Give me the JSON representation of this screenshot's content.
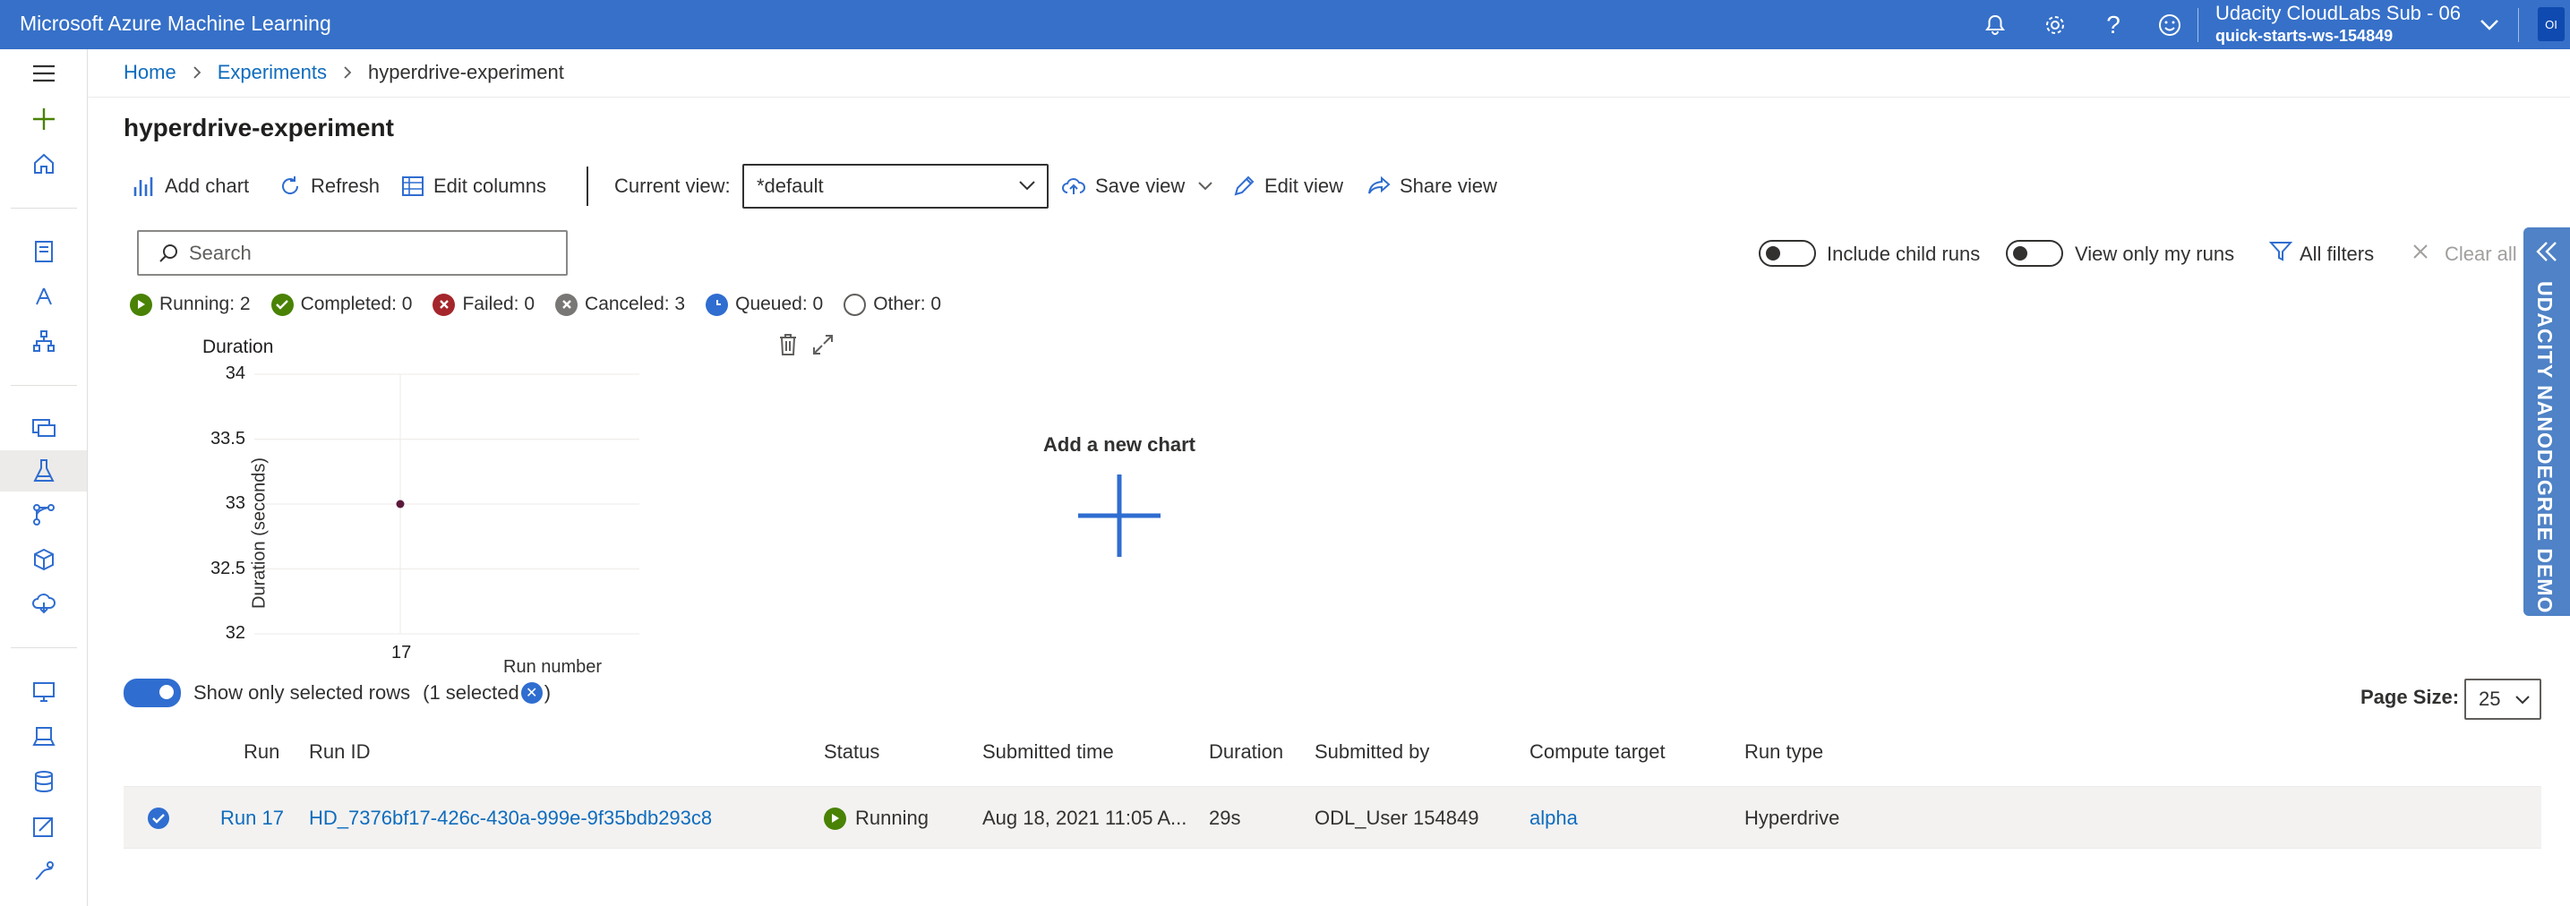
{
  "app": {
    "title": "Microsoft Azure Machine Learning"
  },
  "account": {
    "name": "Udacity CloudLabs Sub - 06",
    "workspace": "quick-starts-ws-154849",
    "initials": "OI"
  },
  "breadcrumb": {
    "items": [
      "Home",
      "Experiments"
    ],
    "current": "hyperdrive-experiment"
  },
  "page": {
    "title": "hyperdrive-experiment"
  },
  "toolbar": {
    "add_chart": "Add chart",
    "refresh": "Refresh",
    "edit_columns": "Edit columns",
    "current_view_label": "Current view:",
    "current_view_value": "*default",
    "save_view": "Save view",
    "edit_view": "Edit view",
    "share_view": "Share view"
  },
  "search": {
    "placeholder": "Search"
  },
  "filters": {
    "include_child_runs": "Include child runs",
    "include_child_runs_on": false,
    "view_only_my_runs": "View only my runs",
    "view_only_my_runs_on": false,
    "all_filters": "All filters",
    "clear_all": "Clear all"
  },
  "status_counts": [
    {
      "label": "Running: 2",
      "color": "#498205",
      "icon": "play-icon"
    },
    {
      "label": "Completed: 0",
      "color": "#498205",
      "icon": "check-icon"
    },
    {
      "label": "Failed: 0",
      "color": "#a4262c",
      "icon": "x-icon"
    },
    {
      "label": "Canceled: 3",
      "color": "#797775",
      "icon": "x-icon"
    },
    {
      "label": "Queued: 0",
      "color": "#2f6dd0",
      "icon": "clock-icon"
    },
    {
      "label": "Other: 0",
      "color": "#ffffff",
      "icon": "circle-icon"
    }
  ],
  "chart_data": {
    "type": "scatter",
    "title": "Duration",
    "xlabel": "Run number",
    "ylabel": "Duration (seconds)",
    "x": [
      17
    ],
    "y": [
      33
    ],
    "x_ticks": [
      "17"
    ],
    "y_ticks": [
      "34",
      "33.5",
      "33",
      "32.5",
      "32"
    ],
    "ylim": [
      32,
      34
    ],
    "grid": true
  },
  "new_chart": {
    "label": "Add a new chart"
  },
  "selection": {
    "toggle_label": "Show only selected rows",
    "toggle_on": true,
    "count_prefix": "(1 selected",
    "count_suffix": ")"
  },
  "page_size": {
    "label": "Page Size:",
    "value": "25"
  },
  "table": {
    "columns": [
      "Run",
      "Run ID",
      "Status",
      "Submitted time",
      "Duration",
      "Submitted by",
      "Compute target",
      "Run type"
    ],
    "rows": [
      {
        "run": "Run 17",
        "run_id": "HD_7376bf17-426c-430a-999e-9f35bdb293c8",
        "status": "Running",
        "submitted_time": "Aug 18, 2021 11:05 A...",
        "duration": "29s",
        "submitted_by": "ODL_User 154849",
        "compute_target": "alpha",
        "run_type": "Hyperdrive"
      }
    ]
  },
  "ribbon": {
    "text": "UDACITY NANODEGREE DEMO"
  }
}
